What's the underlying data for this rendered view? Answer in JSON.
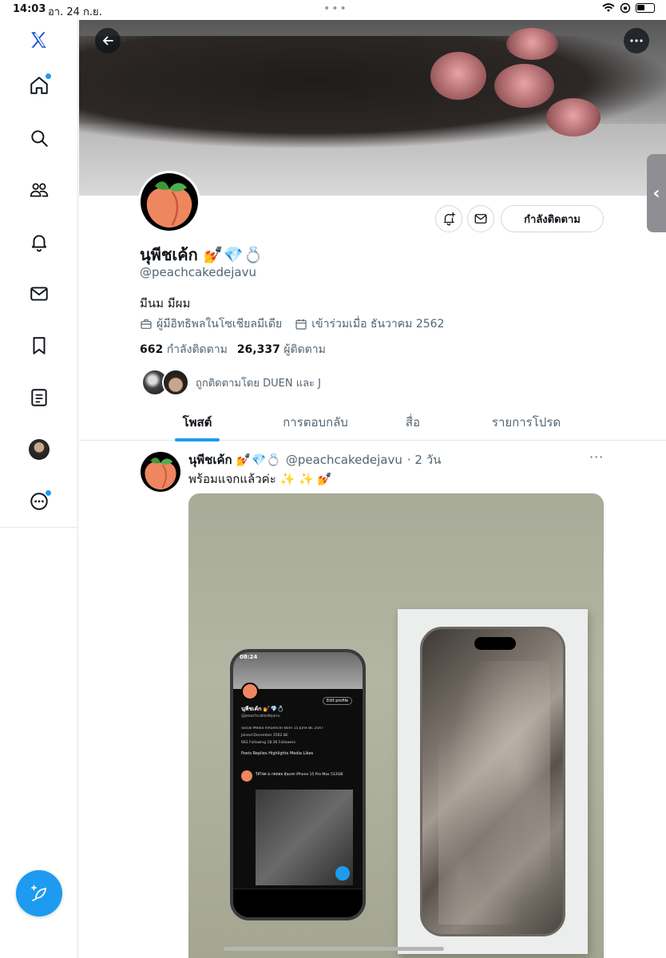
{
  "status_bar": {
    "time": "14:03",
    "date": "อา. 24 ก.ย."
  },
  "profile": {
    "name": "นุพีชเค้ก 💅💎💍",
    "handle": "@peachcakedejavu",
    "bio": "มีนม มีผม",
    "category": "ผู้มีอิทธิพลในโซเชียลมีเดีย",
    "joined": "เข้าร่วมเมื่อ ธันวาคม 2562",
    "following_count": "662",
    "following_label": "กำลังติดตาม",
    "followers_count": "26,337",
    "followers_label": "ผู้ติดตาม",
    "followed_by": "ถูกติดตามโดย DUEN และ J",
    "follow_button": "กำลังติดตาม"
  },
  "tabs": [
    {
      "label": "โพสต์",
      "active": true
    },
    {
      "label": "การตอบกลับ",
      "active": false
    },
    {
      "label": "สื่อ",
      "active": false
    },
    {
      "label": "รายการโปรด",
      "active": false
    }
  ],
  "post": {
    "name": "นุพีชเค้ก 💅💎💍",
    "handle": "@peachcakedejavu",
    "age": "· 2 วัน",
    "text": "พร้อมแจกแล้วค่ะ ✨ ✨ 💅",
    "more": "···"
  },
  "photo_phone": {
    "time": "08:24",
    "name": "นุพีชเค้ก 💅💎💍",
    "handle": "@peachcakedejavu",
    "edit": "Edit profile",
    "line1": "Social Media Influencer   Born 15 June BE 2547",
    "line2": "Joined December 2562 BE",
    "stats": "662 Following  18.3K Followers",
    "tabs": "Posts   Replies   Highlights   Media   Likes",
    "tweet": "ให้โชค & กดหล่อ ลุ้นแจก iPhone 15 Pro Max 512GB"
  },
  "colors": {
    "accent": "#1d9bf0",
    "text": "#0f1419",
    "muted": "#536471",
    "peach": "#ee8660"
  },
  "icons": [
    "x-logo-icon",
    "home-icon",
    "search-icon",
    "communities-icon",
    "bell-icon",
    "mail-icon",
    "bookmark-icon",
    "lists-icon",
    "profile-avatar-icon",
    "more-circle-icon",
    "compose-icon",
    "back-arrow-icon",
    "more-icon",
    "notify-plus-icon",
    "message-icon",
    "briefcase-icon",
    "calendar-icon"
  ]
}
